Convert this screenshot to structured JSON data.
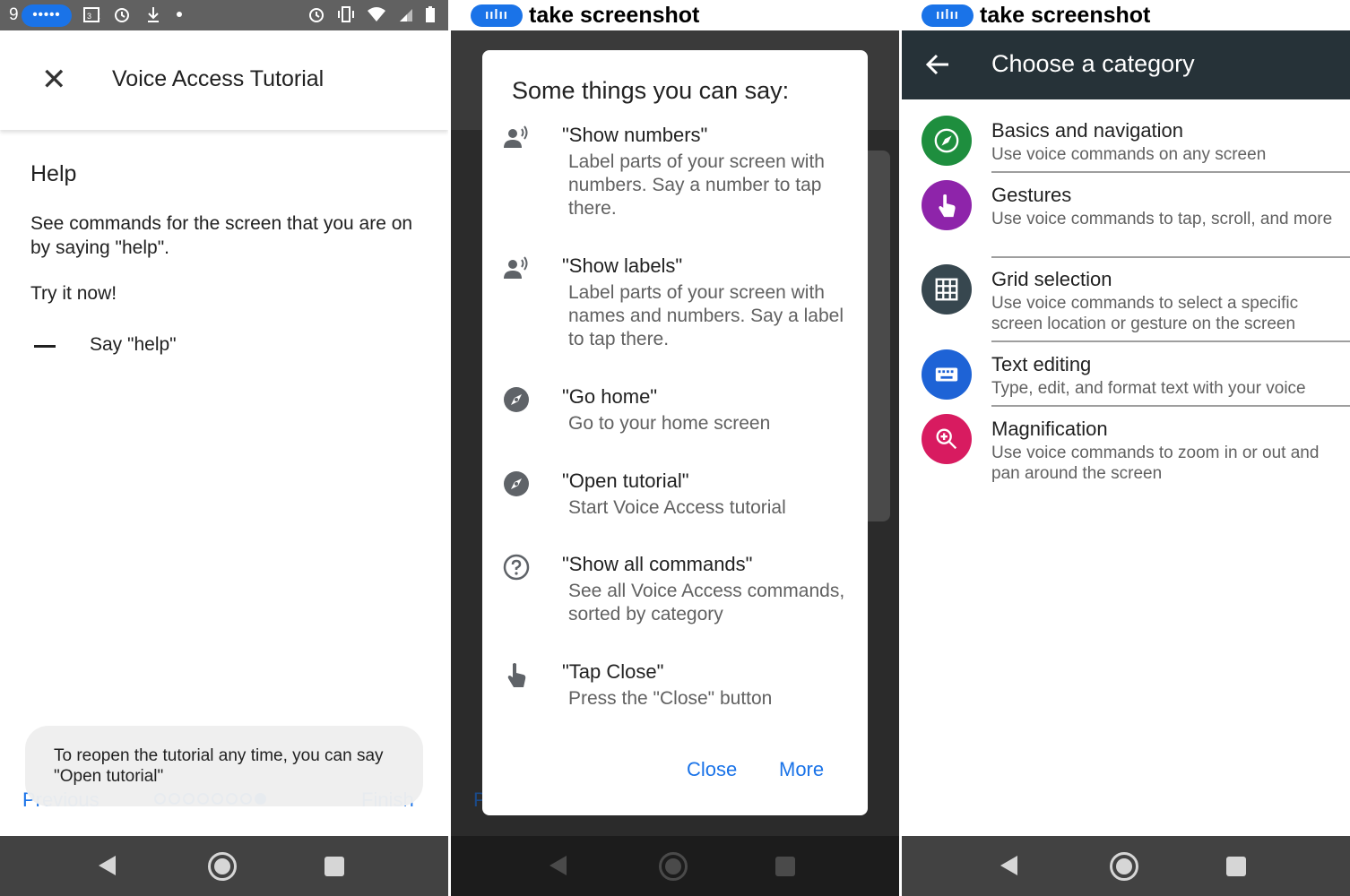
{
  "panel1": {
    "status": {
      "time": "9",
      "assistant_dots": "•••••"
    },
    "toolbar": {
      "title": "Voice Access Tutorial"
    },
    "help_heading": "Help",
    "help_desc": "See commands for the screen that you are on by saying \"help\".",
    "try_now": "Try it now!",
    "step": "Say \"help\"",
    "toast": "To reopen the tutorial any time, you can say \"Open tutorial\"",
    "footer": {
      "previous": "Previous",
      "finish": "Finish"
    },
    "pages": {
      "total": 8,
      "current": 8
    }
  },
  "panel2": {
    "status": {
      "pill": "ıılıı",
      "title": "take screenshot"
    },
    "dialog_title": "Some things you can say:",
    "commands": [
      {
        "name": "\"Show numbers\"",
        "desc": "Label parts of your screen with numbers. Say a number to tap there.",
        "icon": "voice-icon"
      },
      {
        "name": "\"Show labels\"",
        "desc": "Label parts of your screen with names and numbers. Say a label to tap there.",
        "icon": "voice-icon"
      },
      {
        "name": "\"Go home\"",
        "desc": "Go to your home screen",
        "icon": "compass-icon"
      },
      {
        "name": "\"Open tutorial\"",
        "desc": "Start Voice Access tutorial",
        "icon": "compass-icon"
      },
      {
        "name": "\"Show all commands\"",
        "desc": "See all Voice Access commands, sorted by category",
        "icon": "help-circle-icon"
      },
      {
        "name": "\"Tap Close\"",
        "desc": "Press the \"Close\" button",
        "icon": "tap-icon"
      }
    ],
    "buttons": {
      "close": "Close",
      "more": "More"
    },
    "ghost_letter": "P"
  },
  "panel3": {
    "status": {
      "pill": "ıılıı",
      "title": "take screenshot"
    },
    "toolbar": {
      "title": "Choose a category"
    },
    "categories": [
      {
        "title": "Basics and navigation",
        "desc": "Use voice commands on any screen",
        "color": "#1e8e3e",
        "icon": "compass-icon"
      },
      {
        "title": "Gestures",
        "desc": "Use voice commands to tap, scroll, and more",
        "color": "#8e24aa",
        "icon": "tap-icon"
      },
      {
        "title": "Grid selection",
        "desc": "Use voice commands to select a specific screen location or gesture on the screen",
        "color": "#37474f",
        "icon": "grid-icon"
      },
      {
        "title": "Text editing",
        "desc": "Type, edit, and format text with your voice",
        "color": "#1e63d6",
        "icon": "keyboard-icon"
      },
      {
        "title": "Magnification",
        "desc": "Use voice commands to zoom in or out and pan around the screen",
        "color": "#d81b60",
        "icon": "zoom-in-icon"
      }
    ]
  },
  "colors": {
    "accent": "#1a73e8",
    "appbar_dark": "#263238"
  }
}
